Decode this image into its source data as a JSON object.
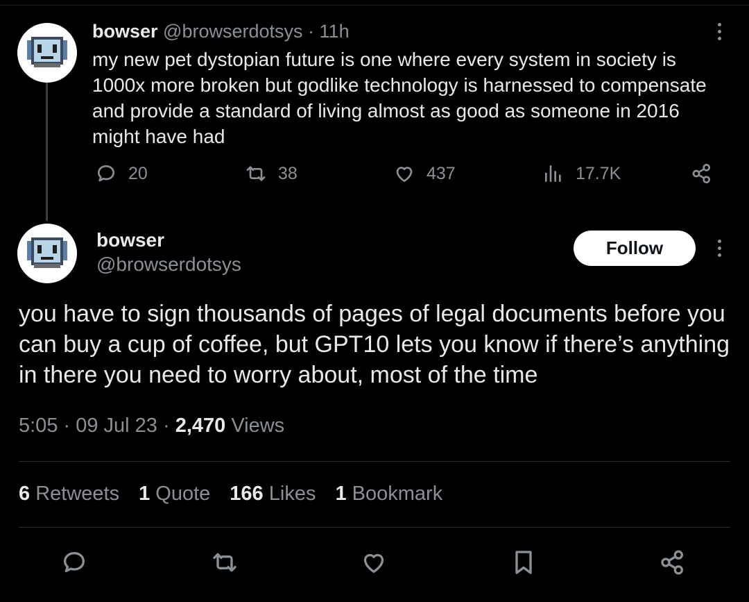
{
  "parent_tweet": {
    "name": "bowser",
    "handle": "@browserdotsys",
    "time": "· 11h",
    "text": "my new pet dystopian future is one where every system in society is 1000x more broken but godlike technology is harnessed to compensate and provide a standard of living almost as good as someone in 2016 might have had",
    "replies": "20",
    "retweets": "38",
    "likes": "437",
    "views": "17.7K"
  },
  "main_tweet": {
    "name": "bowser",
    "handle": "@browserdotsys",
    "follow_label": "Follow",
    "text": "you have to sign thousands of pages of legal documents before you can buy a cup of coffee, but GPT10 lets you know if there’s anything in there you need to worry about, most of the time",
    "time": "5:05 · 09 Jul 23 ·",
    "views_count": "2,470",
    "views_label": "Views",
    "stats": {
      "retweets_count": "6",
      "retweets_label": "Retweets",
      "quotes_count": "1",
      "quotes_label": "Quote",
      "likes_count": "166",
      "likes_label": "Likes",
      "bookmarks_count": "1",
      "bookmarks_label": "Bookmark"
    }
  },
  "icons": [
    "reply-icon",
    "retweet-icon",
    "like-icon",
    "views-icon",
    "share-icon",
    "bookmark-icon",
    "more-icon",
    "avatar-robot-icon"
  ],
  "colors": {
    "background": "#000000",
    "text": "#e7e9ea",
    "muted": "#8b9096",
    "button_bg": "#ffffff"
  }
}
